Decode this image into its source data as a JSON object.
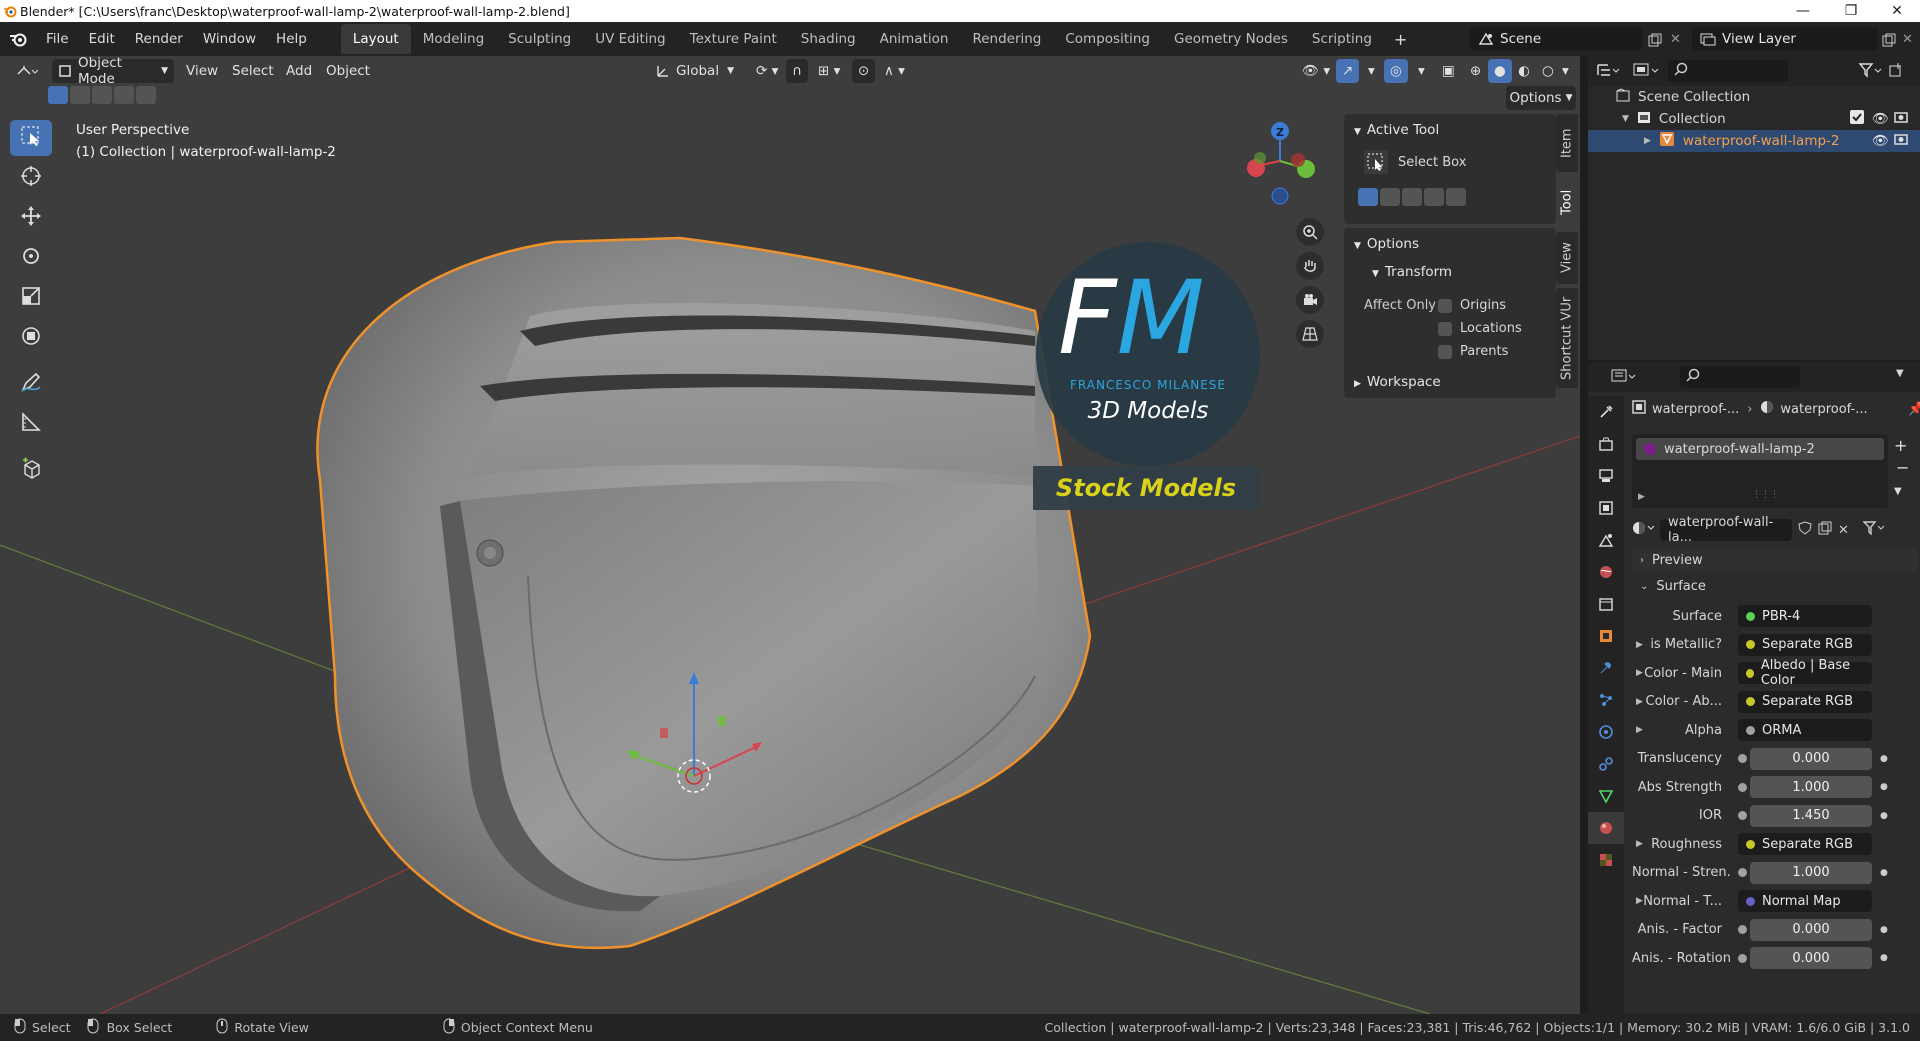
{
  "titlebar": {
    "title": "Blender* [C:\\Users\\franc\\Desktop\\waterproof-wall-lamp-2\\waterproof-wall-lamp-2.blend]",
    "minimize": "—",
    "maximize": "❐",
    "close": "✕"
  },
  "menu": [
    "File",
    "Edit",
    "Render",
    "Window",
    "Help"
  ],
  "workspaces": [
    "Layout",
    "Modeling",
    "Sculpting",
    "UV Editing",
    "Texture Paint",
    "Shading",
    "Animation",
    "Rendering",
    "Compositing",
    "Geometry Nodes",
    "Scripting"
  ],
  "active_workspace": "Layout",
  "scene": "Scene",
  "view_layer": "View Layer",
  "viewport": {
    "mode": "Object Mode",
    "menus": [
      "View",
      "Select",
      "Add",
      "Object"
    ],
    "orientation": "Global",
    "options": "Options",
    "perspective": "User Perspective",
    "collection_info": "(1) Collection | waterproof-wall-lamp-2",
    "axis_z": "Z"
  },
  "watermark": {
    "logo_f": "F",
    "logo_m": "M",
    "brand": "FRANCESCO MILANESE",
    "sub": "3D Models",
    "banner": "Stock Models"
  },
  "npanel": {
    "tabs": [
      "Item",
      "Tool",
      "View",
      "Shortcut VUr"
    ],
    "active_tool_header": "Active Tool",
    "active_tool": "Select Box",
    "options_header": "Options",
    "transform_header": "Transform",
    "affect_only": "Affect Only",
    "checkboxes": [
      "Origins",
      "Locations",
      "Parents"
    ],
    "workspace_header": "Workspace"
  },
  "outliner": {
    "scene_collection": "Scene Collection",
    "collection": "Collection",
    "object": "waterproof-wall-lamp-2"
  },
  "properties": {
    "breadcrumb_obj": "waterproof-...",
    "breadcrumb_mat": "waterproof-...",
    "material_slot": "waterproof-wall-lamp-2",
    "material_name": "waterproof-wall-la...",
    "preview": "Preview",
    "surface_header": "Surface",
    "rows": [
      {
        "label": "Surface",
        "value": "PBR-4",
        "socket": "#5bd15b",
        "expand": false,
        "numeric": false
      },
      {
        "label": "is Metallic?",
        "value": "Separate RGB",
        "socket": "#c7c729",
        "expand": true,
        "numeric": false
      },
      {
        "label": "Color - Main",
        "value": "Albedo | Base Color",
        "socket": "#c7c729",
        "expand": true,
        "numeric": false
      },
      {
        "label": "Color - Ab...",
        "value": "Separate RGB",
        "socket": "#c7c729",
        "expand": true,
        "numeric": false
      },
      {
        "label": "Alpha",
        "value": "ORMA",
        "socket": "#a1a1a1",
        "expand": true,
        "numeric": false
      },
      {
        "label": "Translucency",
        "value": "0.000",
        "socket": "#a1a1a1",
        "expand": false,
        "numeric": true
      },
      {
        "label": "Abs Strength",
        "value": "1.000",
        "socket": "#a1a1a1",
        "expand": false,
        "numeric": true
      },
      {
        "label": "IOR",
        "value": "1.450",
        "socket": "#a1a1a1",
        "expand": false,
        "numeric": true
      },
      {
        "label": "Roughness",
        "value": "Separate RGB",
        "socket": "#c7c729",
        "expand": true,
        "numeric": false
      },
      {
        "label": "Normal - Stren...",
        "value": "1.000",
        "socket": "#a1a1a1",
        "expand": false,
        "numeric": true
      },
      {
        "label": "Normal - T...",
        "value": "Normal Map",
        "socket": "#6363c7",
        "expand": true,
        "numeric": false
      },
      {
        "label": "Anis. - Factor",
        "value": "0.000",
        "socket": "#a1a1a1",
        "expand": false,
        "numeric": true
      },
      {
        "label": "Anis. - Rotation",
        "value": "0.000",
        "socket": "#a1a1a1",
        "expand": false,
        "numeric": true
      }
    ]
  },
  "statusbar": {
    "select": "Select",
    "box_select": "Box Select",
    "rotate_view": "Rotate View",
    "context_menu": "Object Context Menu",
    "stats": "Collection | waterproof-wall-lamp-2 | Verts:23,348 | Faces:23,381 | Tris:46,762 | Objects:1/1 | Memory: 30.2 MiB | VRAM: 1.6/6.0 GiB | 3.1.0"
  },
  "colors": {
    "accent": "#4772b3",
    "selection_outline": "#f0922b",
    "banner_text": "#d9d11a",
    "logo_m": "#2aa6e0"
  }
}
